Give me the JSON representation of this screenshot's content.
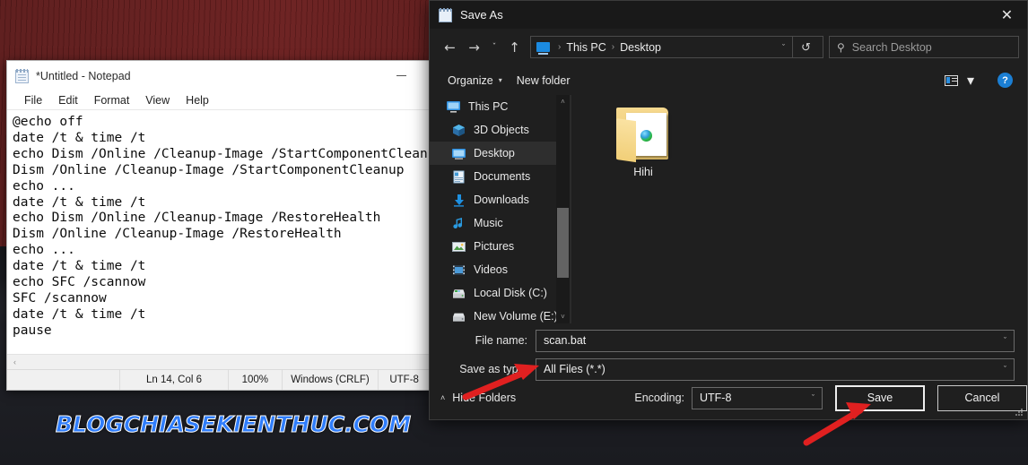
{
  "desktop": {
    "watermark": "BLOGCHIASEKIENTHUC.COM",
    "wallpaper_description": "dark red brick wall with car"
  },
  "notepad": {
    "title": "*Untitled - Notepad",
    "icon": "notepad-icon",
    "minimize_label": "–",
    "menu": [
      {
        "label": "File"
      },
      {
        "label": "Edit"
      },
      {
        "label": "Format"
      },
      {
        "label": "View"
      },
      {
        "label": "Help"
      }
    ],
    "content_lines": [
      "@echo off",
      "date /t & time /t",
      "echo Dism /Online /Cleanup-Image /StartComponentCleanup",
      "Dism /Online /Cleanup-Image /StartComponentCleanup",
      "echo ...",
      "date /t & time /t",
      "echo Dism /Online /Cleanup-Image /RestoreHealth",
      "Dism /Online /Cleanup-Image /RestoreHealth",
      "echo ...",
      "date /t & time /t",
      "echo SFC /scannow",
      "SFC /scannow",
      "date /t & time /t",
      "pause"
    ],
    "status": {
      "cursor_position": "Ln 14, Col 6",
      "zoom": "100%",
      "line_ending": "Windows (CRLF)",
      "encoding": "UTF-8"
    },
    "hscroll_left_arrow": "‹"
  },
  "dialog": {
    "title": "Save As",
    "title_icon": "notepad-icon",
    "close_label": "✕",
    "nav": {
      "back": "←",
      "forward": "→",
      "recent": "ˇ",
      "up": "↑",
      "refresh": "↺",
      "dropdown_chevron": "ˇ"
    },
    "breadcrumb": {
      "root_icon": "this-pc-icon",
      "separator": "›",
      "segments": [
        "This PC",
        "Desktop"
      ]
    },
    "search": {
      "icon": "search-icon",
      "placeholder": "Search Desktop",
      "value": ""
    },
    "commandbar": {
      "organize": "Organize",
      "organize_caret": "▾",
      "new_folder": "New folder",
      "view_icon": "view-layout-icon",
      "view_caret": "▾",
      "help_icon": "help-icon",
      "help_label": "?"
    },
    "sidebar": {
      "items": [
        {
          "label": "This PC",
          "icon": "monitor-icon",
          "selected": false,
          "indent": 0
        },
        {
          "label": "3D Objects",
          "icon": "cube-icon",
          "selected": false,
          "indent": 1
        },
        {
          "label": "Desktop",
          "icon": "desktop-icon",
          "selected": true,
          "indent": 1
        },
        {
          "label": "Documents",
          "icon": "document-icon",
          "selected": false,
          "indent": 1
        },
        {
          "label": "Downloads",
          "icon": "download-icon",
          "selected": false,
          "indent": 1
        },
        {
          "label": "Music",
          "icon": "music-icon",
          "selected": false,
          "indent": 1
        },
        {
          "label": "Pictures",
          "icon": "pictures-icon",
          "selected": false,
          "indent": 1
        },
        {
          "label": "Videos",
          "icon": "video-icon",
          "selected": false,
          "indent": 1
        },
        {
          "label": "Local Disk (C:)",
          "icon": "disk-icon",
          "selected": false,
          "indent": 1
        },
        {
          "label": "New Volume (E:)",
          "icon": "disk-icon",
          "selected": false,
          "indent": 1
        }
      ],
      "scroll_up": "˄",
      "scroll_down": "˅"
    },
    "files": [
      {
        "name": "Hihi",
        "type": "folder",
        "icon": "folder-icon"
      }
    ],
    "form": {
      "file_name_label": "File name:",
      "file_name_value": "scan.bat",
      "save_as_type_label": "Save as type:",
      "save_as_type_value": "All Files  (*.*)",
      "chevron": "ˇ",
      "hide_folders_caret": "˄",
      "hide_folders_label": "Hide Folders",
      "encoding_label": "Encoding:",
      "encoding_value": "UTF-8",
      "save_button": "Save",
      "cancel_button": "Cancel"
    }
  },
  "annotations": {
    "arrow_color": "#e02020",
    "arrows": [
      {
        "name": "arrow-to-save-as-type",
        "points_at": "Save as type"
      },
      {
        "name": "arrow-to-save-button",
        "points_at": "Save"
      }
    ]
  },
  "colors": {
    "dialog_bg": "#1f1f1f",
    "dialog_title_bg": "#191919",
    "selection_bg": "#2e2e2e",
    "accent_blue": "#1b7fd4",
    "notepad_bg": "#ffffff",
    "arrow_red": "#e02020",
    "watermark_blue": "#2f7dfb"
  }
}
